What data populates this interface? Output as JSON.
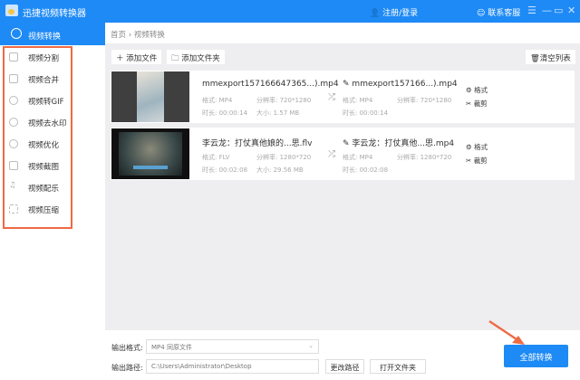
{
  "app": {
    "title": "迅捷视频转换器",
    "login": "注册/登录",
    "service": "联系客服"
  },
  "sidebar": {
    "active": "视频转换",
    "items": [
      {
        "label": "视频分割",
        "icon": "split-icon"
      },
      {
        "label": "视频合并",
        "icon": "merge-icon"
      },
      {
        "label": "视频转GIF",
        "icon": "gif-icon"
      },
      {
        "label": "视频去水印",
        "icon": "watermark-icon"
      },
      {
        "label": "视频优化",
        "icon": "optimize-icon"
      },
      {
        "label": "视频截图",
        "icon": "screenshot-icon"
      },
      {
        "label": "视频配乐",
        "icon": "music-icon"
      },
      {
        "label": "视频压缩",
        "icon": "compress-icon"
      }
    ]
  },
  "breadcrumb": {
    "home": "首页",
    "sep": "›",
    "current": "视频转换"
  },
  "toolbar": {
    "add_file": "添加文件",
    "add_folder": "添加文件夹",
    "clear": "清空列表"
  },
  "files": [
    {
      "name": "mmexport157166647365...).mp4",
      "format": "格式: MP4",
      "resolution": "分辨率: 720*1280",
      "duration": "时长: 00:00:14",
      "size": "大小:  1.57 MB",
      "out_name": "mmexport157166...).mp4",
      "out_format": "格式: MP4",
      "out_resolution": "分辨率: 720*1280",
      "out_duration": "时长: 00:00:14",
      "action_format": "格式",
      "action_clip": "裁剪"
    },
    {
      "name": "李云龙：打仗真他娘的...思.flv",
      "format": "格式: FLV",
      "resolution": "分辨率: 1280*720",
      "duration": "时长: 00:02:08",
      "size": "大小:  29.56 MB",
      "out_name": "李云龙：打仗真他...思.mp4",
      "out_format": "格式: MP4",
      "out_resolution": "分辨率: 1280*720",
      "out_duration": "时长: 00:02:08",
      "action_format": "格式",
      "action_clip": "裁剪"
    }
  ],
  "bottom": {
    "format_label": "输出格式:",
    "format_value": "MP4  同原文件",
    "path_label": "输出路径:",
    "path_value": "C:\\Users\\Administrator\\Desktop",
    "change_path": "更改路径",
    "open_folder": "打开文件夹",
    "convert_all": "全部转换"
  },
  "colors": {
    "brand": "#1e8af5",
    "highlight": "#ee6b45"
  }
}
